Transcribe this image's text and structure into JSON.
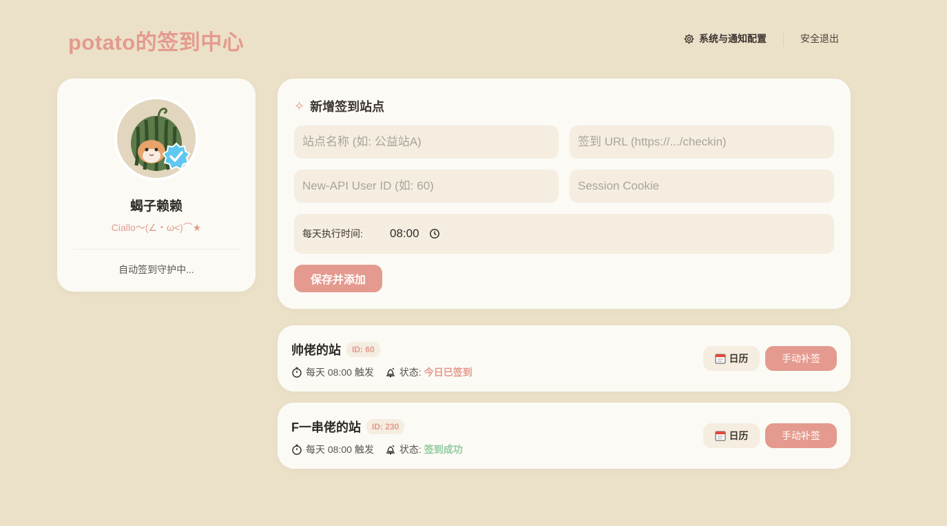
{
  "header": {
    "brand": "potato的签到中心",
    "config_label": "系统与通知配置",
    "logout_label": "安全退出"
  },
  "profile": {
    "name": "蝎子赖赖",
    "motto": "Ciallo～(∠・ω<)⌒★",
    "status": "自动签到守护中..."
  },
  "form": {
    "title": "新增签到站点",
    "site_name_placeholder": "站点名称 (如: 公益站A)",
    "url_placeholder": "签到 URL (https://.../checkin)",
    "user_id_placeholder": "New-API User ID (如: 60)",
    "cookie_placeholder": "Session Cookie",
    "time_label": "每天执行时间:",
    "time_value": "08:00",
    "save_label": "保存并添加"
  },
  "sites": [
    {
      "name": "帅佬的站",
      "id": "ID: 60",
      "trigger": "每天 08:00 触发",
      "status_label": "状态:",
      "status": "今日已签到",
      "calendar_label": "日历",
      "manual_label": "手动补签"
    },
    {
      "name": "F一串佬的站",
      "id": "ID: 230",
      "trigger": "每天 08:00 触发",
      "status_label": "状态:",
      "status": "签到成功",
      "calendar_label": "日历",
      "manual_label": "手动补签"
    }
  ],
  "colors": {
    "background": "#ebe1c8",
    "accent": "#e49a8e",
    "success": "#8fcc9f",
    "card": "#fbfaf5",
    "field": "#f4ede0"
  },
  "icons": {
    "config": "gear-icon",
    "title": "sparkle-icon",
    "trigger": "stopwatch-icon",
    "status": "bell-icon",
    "calendar": "calendar-icon",
    "time": "clock-icon",
    "verified": "verified-badge-icon"
  }
}
